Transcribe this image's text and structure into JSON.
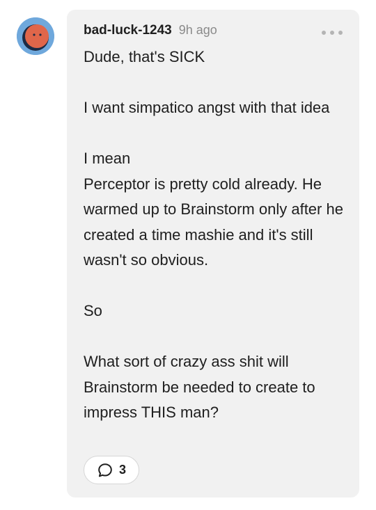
{
  "comment": {
    "author": "bad-luck-1243",
    "timestamp": "9h ago",
    "paragraphs": [
      "Dude, that's SICK",
      "I want simpatico angst with that idea",
      "I mean\nPerceptor is pretty cold already. He warmed up to Brainstorm only after he created a time mashie and it's still wasn't so obvious.",
      "So",
      "What sort of crazy ass shit will Brainstorm be needed to create to impress THIS man?"
    ],
    "reply_count": "3",
    "icons": {
      "more": "more-horizontal-icon",
      "replies": "speech-bubble-icon"
    }
  },
  "colors": {
    "card_background": "#f1f1f1",
    "avatar_background": "#6fa8dc",
    "avatar_face": "#e0664a",
    "timestamp": "#8a8a8a"
  }
}
